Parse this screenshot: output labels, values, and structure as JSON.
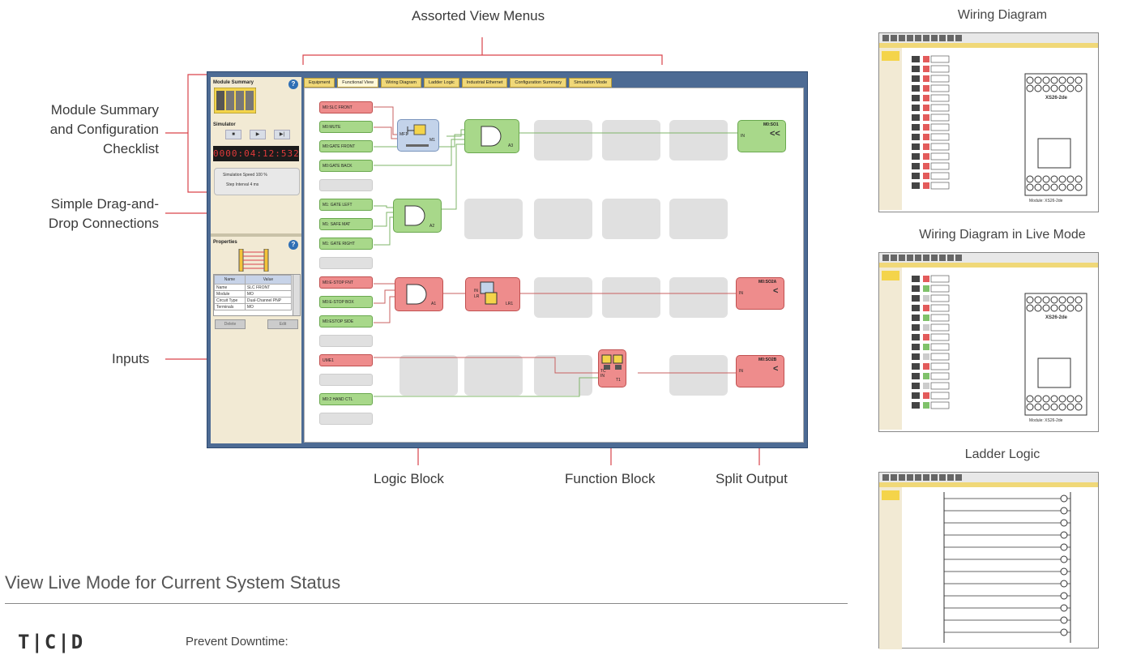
{
  "callouts": {
    "assorted_menus": "Assorted View Menus",
    "module_summary": [
      "Module Summary",
      "and Configuration",
      "Checklist"
    ],
    "drag_drop": [
      "Simple Drag-and-",
      "Drop Connections"
    ],
    "inputs": "Inputs",
    "logic_block": "Logic Block",
    "function_block": "Function Block",
    "split_output": "Split Output"
  },
  "app": {
    "module_summary_title": "Module Summary",
    "simulator_title": "Simulator",
    "timer": "0000:04:12:532",
    "sim_speed": "Simulation Speed  100 %",
    "step_interval": "Step Interval  4 ms",
    "properties_title": "Properties",
    "prop_headers": [
      "Name",
      "Value"
    ],
    "prop_rows": [
      [
        "Name",
        "SLC FRONT"
      ],
      [
        "Module",
        "MO"
      ],
      [
        "Circuit Type",
        "Dual-Channel PNP"
      ],
      [
        "Terminals",
        "MO"
      ]
    ],
    "buttons": [
      "Delete",
      "Edit"
    ],
    "tabs": [
      "Equipment",
      "Functional View",
      "Wiring Diagram",
      "Ladder Logic",
      "Industrial Ethernet",
      "Configuration Summary",
      "Simulation Mode"
    ],
    "inputs": [
      {
        "label": "M0:SLC FRONT",
        "color": "red"
      },
      {
        "label": "M0:MUTE",
        "color": "green"
      },
      {
        "label": "M0:GATE FRONT",
        "color": "green"
      },
      {
        "label": "M0:GATE BACK",
        "color": "green"
      },
      {
        "label": "",
        "color": "empty"
      },
      {
        "label": "M1: GATE LEFT",
        "color": "green"
      },
      {
        "label": "M1: SAFE MAT",
        "color": "green"
      },
      {
        "label": "M1: GATE RIGHT",
        "color": "green"
      },
      {
        "label": "",
        "color": "empty"
      },
      {
        "label": "M0:E-STOP FNT",
        "color": "red"
      },
      {
        "label": "M0:E-STOP BOX",
        "color": "green"
      },
      {
        "label": "M0:ESTOP SIDE",
        "color": "green"
      },
      {
        "label": "",
        "color": "empty"
      },
      {
        "label": "UME1",
        "color": "red"
      },
      {
        "label": "",
        "color": "empty"
      },
      {
        "label": "M0:2 HAND CTL",
        "color": "green"
      },
      {
        "label": "",
        "color": "empty"
      }
    ],
    "blocks": {
      "mf1": "MF1",
      "m1": "M1",
      "a3": "A3",
      "a2": "A2",
      "a1": "A1",
      "lr1": "LR1",
      "t1": "T1",
      "in": "IN",
      "tc": "TC",
      "lr": "LR"
    },
    "outputs": {
      "o1": "M0:SO1",
      "o2": "M0:SO2A",
      "o3": "M0:SO2B",
      "in": "IN"
    }
  },
  "bottom": {
    "heading": "View Live Mode for Current System Status",
    "logo": "T|C|D",
    "subhead": "Prevent Downtime:"
  },
  "thumbs": {
    "wiring": "Wiring Diagram",
    "wiring_live": "Wiring Diagram in Live Mode",
    "ladder": "Ladder Logic",
    "module_label": "XS26-2de",
    "module_caption": "Module: XS26-2de"
  },
  "colors": {
    "red_line": "#d9434b",
    "green": "#a8d88a",
    "red_block": "#ee8c8c",
    "app_frame": "#4d6b94"
  }
}
